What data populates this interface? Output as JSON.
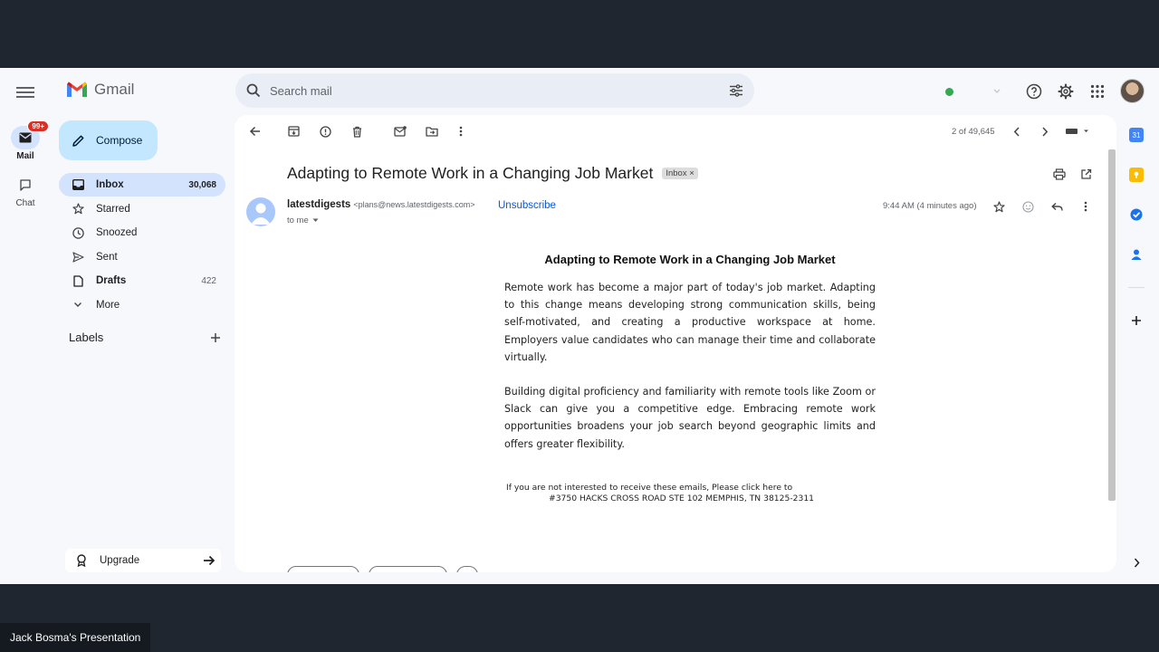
{
  "app": {
    "brand": "Gmail"
  },
  "rail": {
    "mail_label": "Mail",
    "mail_badge": "99+",
    "chat_label": "Chat"
  },
  "search": {
    "placeholder": "Search mail"
  },
  "sidebar": {
    "compose_label": "Compose",
    "items": [
      {
        "label": "Inbox",
        "count": "30,068"
      },
      {
        "label": "Starred",
        "count": ""
      },
      {
        "label": "Snoozed",
        "count": ""
      },
      {
        "label": "Sent",
        "count": ""
      },
      {
        "label": "Drafts",
        "count": "422"
      },
      {
        "label": "More",
        "count": ""
      }
    ],
    "labels_heading": "Labels",
    "upgrade_label": "Upgrade"
  },
  "toolbar": {
    "pager": "2 of 49,645"
  },
  "email": {
    "subject": "Adapting to Remote Work in a Changing Job Market",
    "inbox_chip": "Inbox ×",
    "sender_name": "latestdigests",
    "sender_email": "<plans@news.latestdigests.com>",
    "unsubscribe": "Unsubscribe",
    "to": "to me",
    "time": "9:44 AM (4 minutes ago)",
    "body_title": "Adapting to Remote Work in a Changing Job Market",
    "paragraphs": [
      "Remote work has become a major part of today's job market. Adapting to this change means developing strong communication skills, being self-motivated, and creating a productive workspace at home. Employers value candidates who can manage their time and collaborate virtually.",
      "Building digital proficiency and familiarity with remote tools like Zoom or Slack can give you a competitive edge. Embracing remote work opportunities broadens your job search beyond geographic limits and offers greater flexibility."
    ],
    "footer_line1": "If you are not interested to receive these emails, Please click here to",
    "footer_line2": "#3750 HACKS CROSS ROAD STE 102 MEMPHIS, TN 38125-2311"
  },
  "side_panel": {
    "calendar_day": "31"
  },
  "presentation": {
    "label": "Jack Bosma's Presentation"
  },
  "colors": {
    "accent": "#0b57d0",
    "compose_bg": "#c2e7ff",
    "selected_nav": "#d3e3fd",
    "badge": "#d93025",
    "status_dot": "#34a853"
  }
}
